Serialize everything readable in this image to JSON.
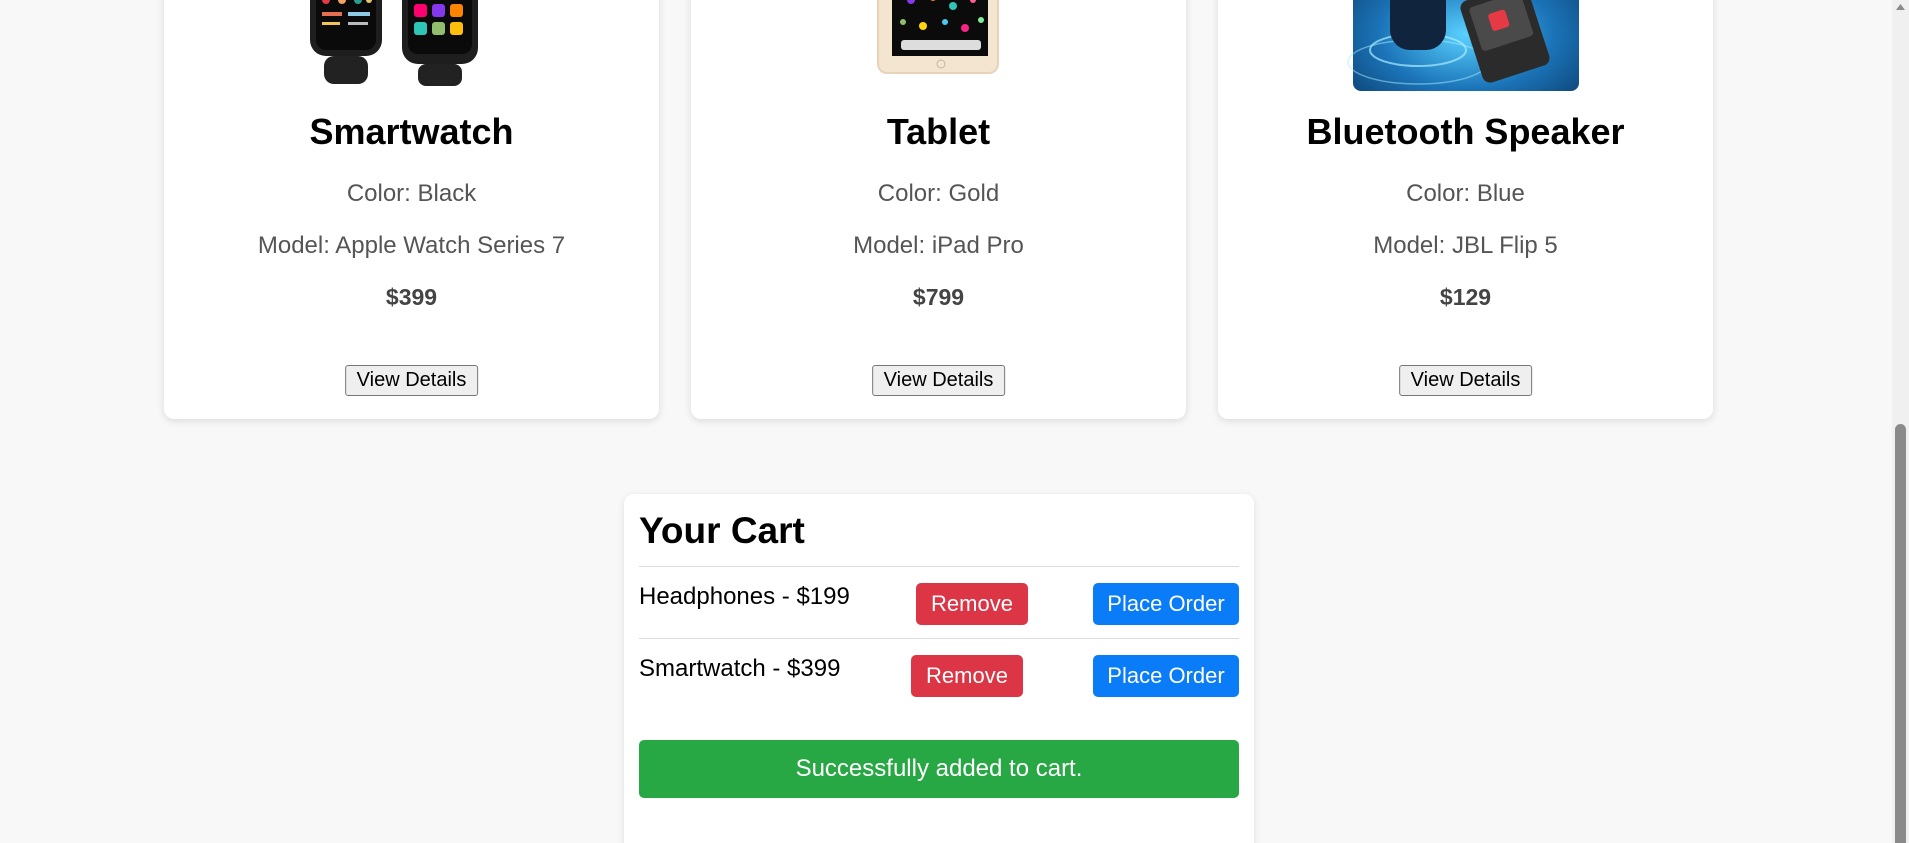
{
  "products": [
    {
      "name": "Smartwatch",
      "color": "Color: Black",
      "model": "Model: Apple Watch Series 7",
      "price": "$399",
      "details_label": "View Details",
      "icon": "smartwatch-image"
    },
    {
      "name": "Tablet",
      "color": "Color: Gold",
      "model": "Model: iPad Pro",
      "price": "$799",
      "details_label": "View Details",
      "icon": "tablet-image"
    },
    {
      "name": "Bluetooth Speaker",
      "color": "Color: Blue",
      "model": "Model: JBL Flip 5",
      "price": "$129",
      "details_label": "View Details",
      "icon": "speaker-image"
    }
  ],
  "cart": {
    "title": "Your Cart",
    "items": [
      {
        "text": "Headphones - $199",
        "remove_label": "Remove",
        "order_label": "Place Order"
      },
      {
        "text": "Smartwatch - $399",
        "remove_label": "Remove",
        "order_label": "Place Order"
      }
    ],
    "message": "Successfully added to cart."
  },
  "colors": {
    "remove": "#dc3545",
    "order": "#0a7cf7",
    "success": "#28a745",
    "background": "#f8f8f8"
  }
}
